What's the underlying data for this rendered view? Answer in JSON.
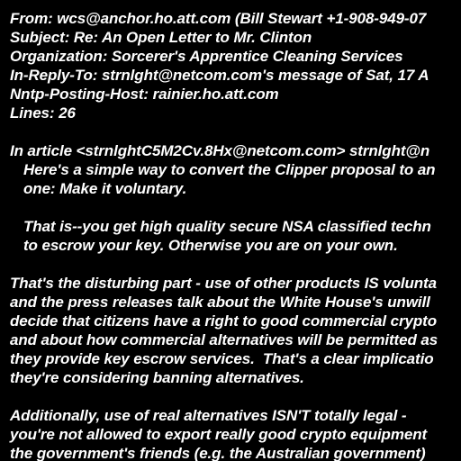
{
  "colors": {
    "background": "#000000",
    "text": "#ffffff"
  },
  "email": {
    "header": {
      "from": "From: wcs@anchor.ho.att.com (Bill Stewart +1-908-949-07",
      "subject": "Subject: Re: An Open Letter to Mr. Clinton",
      "organization": "Organization: Sorcerer's Apprentice Cleaning Services",
      "in_reply_to": "In-Reply-To: strnlght@netcom.com's message of Sat, 17 A",
      "nntp_posting_host": "Nntp-Posting-Host: rainier.ho.att.com",
      "lines": "Lines: 26"
    },
    "body": {
      "attribution": "In article <strnlghtC5M2Cv.8Hx@netcom.com> strnlght@n",
      "quote1_line1": "Here's a simple way to convert the Clipper proposal to an",
      "quote1_line2": "one: Make it voluntary.",
      "quote2_line1": "That is--you get high quality secure NSA classified techn",
      "quote2_line2": "to escrow your key. Otherwise you are on your own.",
      "para1_line1": "That's the disturbing part - use of other products IS volunta",
      "para1_line2": "and the press releases talk about the White House's unwill",
      "para1_line3": "decide that citizens have a right to good commercial crypto",
      "para1_line4": "and about how commercial alternatives will be permitted as",
      "para1_line5": "they provide key escrow services.  That's a clear implicatio",
      "para1_line6": "they're considering banning alternatives.",
      "para2_line1": "Additionally, use of real alternatives ISN'T totally legal -",
      "para2_line2": "you're not allowed to export really good crypto equipment",
      "para2_line3": "the government's friends (e.g. the Australian government)"
    }
  }
}
